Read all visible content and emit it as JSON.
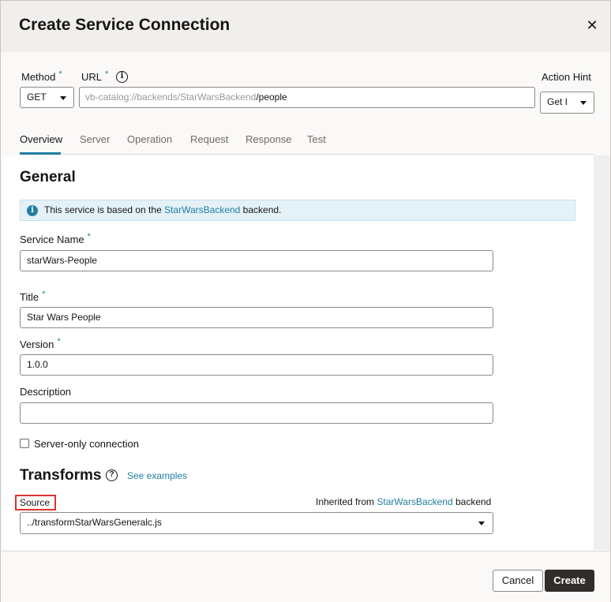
{
  "dialog": {
    "title": "Create Service Connection",
    "close_label": "✕"
  },
  "request": {
    "method_label": "Method",
    "method_value": "GET",
    "url_label": "URL",
    "url_prefix": "vb-catalog://backends/StarWarsBackend",
    "url_path": "/people",
    "action_hint_label": "Action Hint",
    "action_hint_value": "Get I"
  },
  "tabs": [
    {
      "label": "Overview",
      "active": true
    },
    {
      "label": "Server"
    },
    {
      "label": "Operation"
    },
    {
      "label": "Request"
    },
    {
      "label": "Response"
    },
    {
      "label": "Test"
    }
  ],
  "general": {
    "heading": "General",
    "banner_prefix": "This service is based on the ",
    "banner_link": "StarWarsBackend",
    "banner_suffix": " backend.",
    "service_name_label": "Service Name",
    "service_name_value": "starWars-People",
    "title_label": "Title",
    "title_value": "Star Wars People",
    "version_label": "Version",
    "version_value": "1.0.0",
    "description_label": "Description",
    "description_value": "",
    "server_only_label": "Server-only connection"
  },
  "transforms": {
    "heading": "Transforms",
    "see_examples": "See examples",
    "source_label": "Source",
    "inherited_prefix": "Inherited from ",
    "inherited_link": "StarWarsBackend",
    "inherited_suffix": " backend",
    "source_value": "../transformStarWarsGeneralc.js"
  },
  "footer": {
    "cancel_label": "Cancel",
    "create_label": "Create"
  },
  "colors": {
    "accent": "#227fa3",
    "primary_button": "#312d2a",
    "highlight_border": "#e0332f"
  }
}
